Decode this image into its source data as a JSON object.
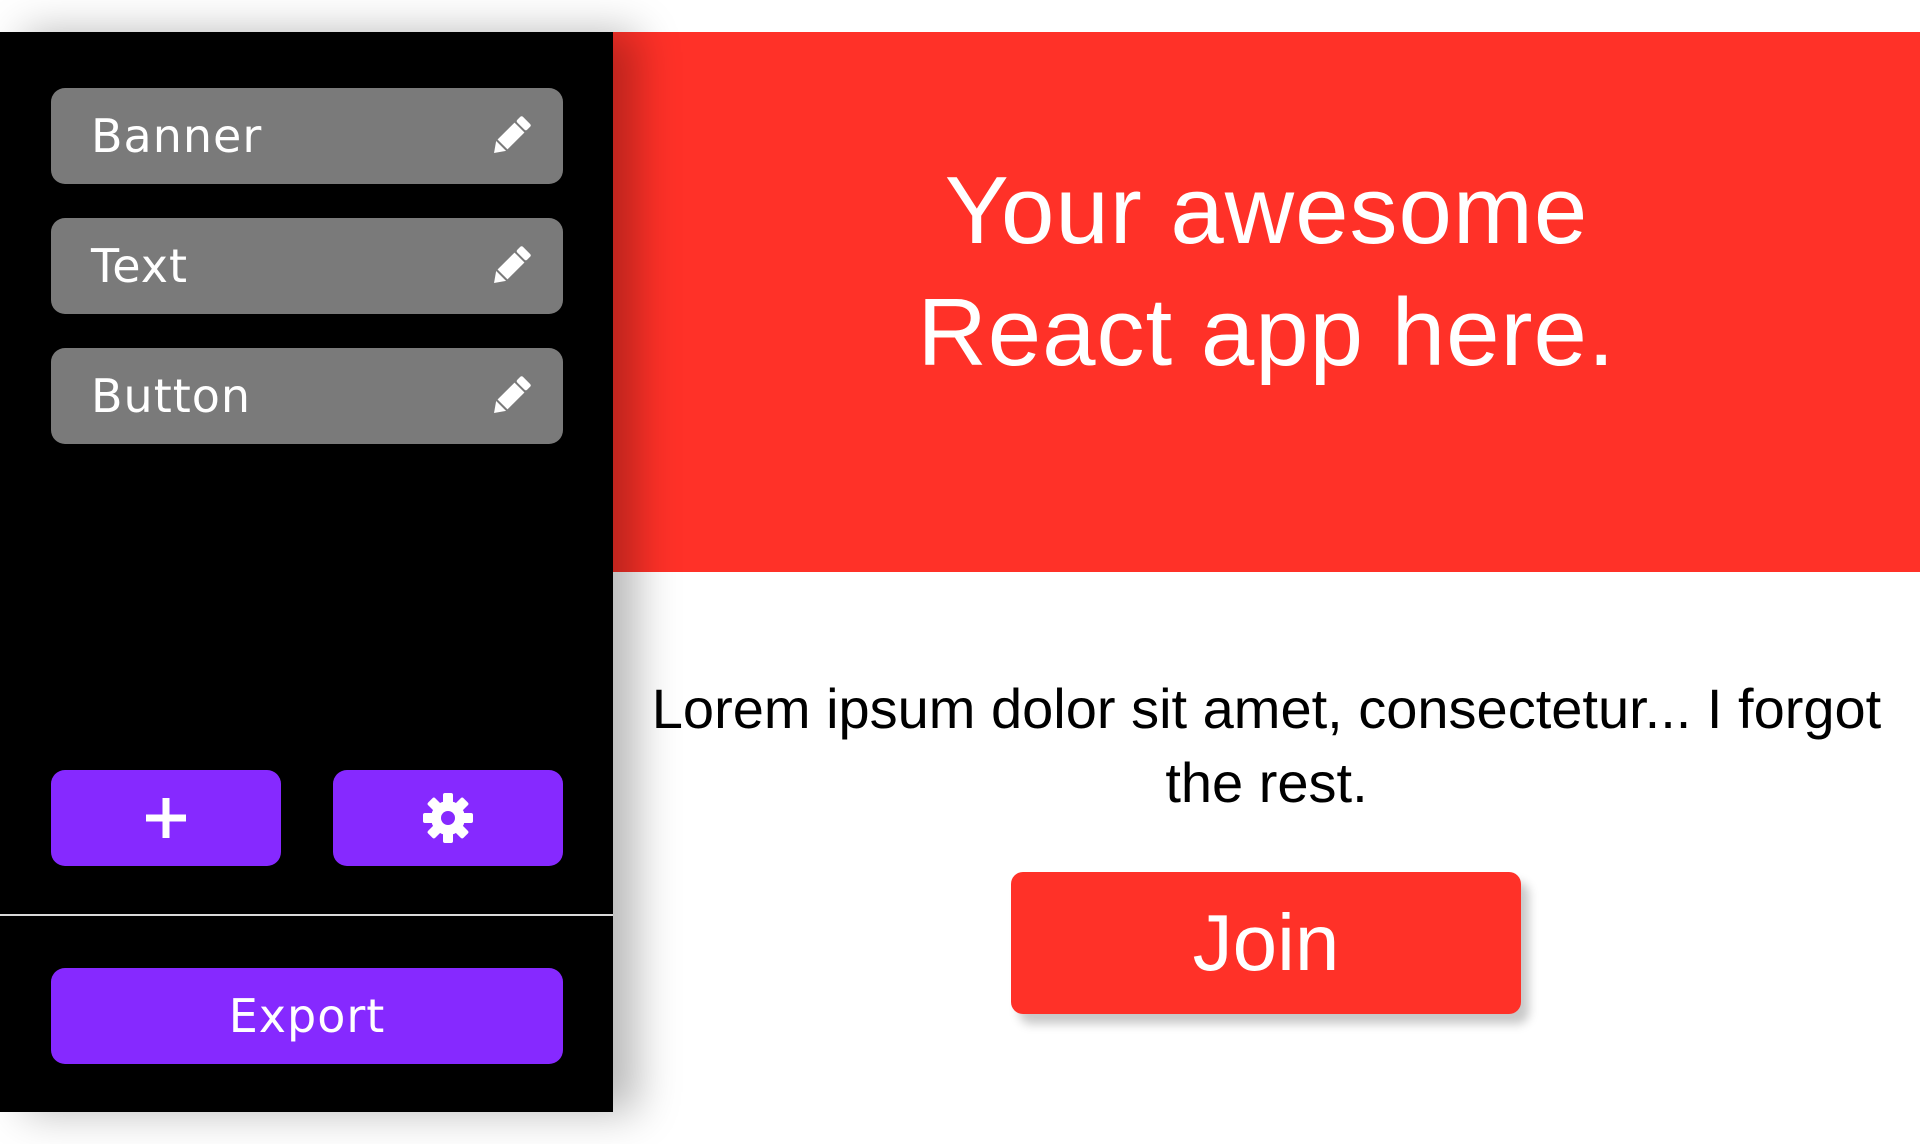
{
  "editor": {
    "components": [
      {
        "label": "Banner",
        "icon": "pencil-icon"
      },
      {
        "label": "Text",
        "icon": "pencil-icon"
      },
      {
        "label": "Button",
        "icon": "pencil-icon"
      }
    ],
    "add_icon": "plus-icon",
    "settings_icon": "gear-icon",
    "export_label": "Export"
  },
  "preview": {
    "banner_title": "Your awesome React app here.",
    "body_text": "Lorem ipsum dolor sit amet, consectetur... I forgot the rest.",
    "join_label": "Join"
  },
  "colors": {
    "sidebar_background": "#000000",
    "component_item": "#7a7a7a",
    "accent_purple": "#8629ff",
    "brand_red": "#ff3128",
    "text_light": "#ffffff"
  }
}
